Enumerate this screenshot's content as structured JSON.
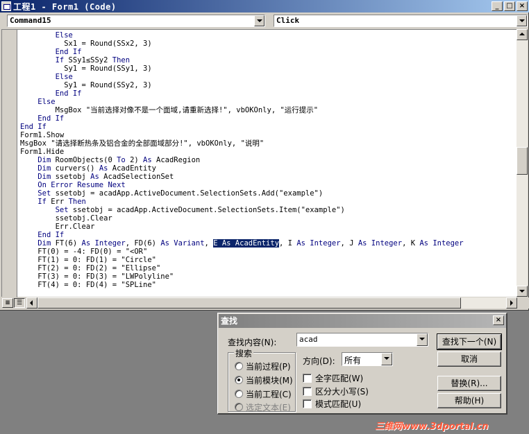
{
  "window": {
    "title": "工程1 - Form1 (Code)",
    "object_combo": "Command15",
    "procedure_combo": "Click"
  },
  "code_lines": [
    [
      {
        "t": "        "
      },
      {
        "t": "Else",
        "c": "kw"
      }
    ],
    [
      {
        "t": "          Sx1 = Round(SSx2, 3)"
      }
    ],
    [
      {
        "t": "        "
      },
      {
        "t": "End If",
        "c": "kw"
      }
    ],
    [
      {
        "t": "        "
      },
      {
        "t": "If",
        "c": "kw"
      },
      {
        "t": " SSy1≤SSy2 "
      },
      {
        "t": "Then",
        "c": "kw"
      }
    ],
    [
      {
        "t": "          Sy1 = Round(SSy1, 3)"
      }
    ],
    [
      {
        "t": "        "
      },
      {
        "t": "Else",
        "c": "kw"
      }
    ],
    [
      {
        "t": "          Sy1 = Round(SSy2, 3)"
      }
    ],
    [
      {
        "t": "        "
      },
      {
        "t": "End If",
        "c": "kw"
      }
    ],
    [
      {
        "t": "    "
      },
      {
        "t": "Else",
        "c": "kw"
      }
    ],
    [
      {
        "t": "        MsgBox \"当前选择对像不是一个面域,请重新选择!\", vbOKOnly, \"运行提示\""
      }
    ],
    [
      {
        "t": "    "
      },
      {
        "t": "End If",
        "c": "kw"
      }
    ],
    [
      {
        "t": "End If",
        "c": "kw"
      }
    ],
    [
      {
        "t": "Form1.Show"
      }
    ],
    [
      {
        "t": "MsgBox \"请选择断热条及铝合金的全部面域部分!\", vbOKOnly, \"说明\""
      }
    ],
    [
      {
        "t": "Form1.Hide"
      }
    ],
    [
      {
        "t": "    "
      },
      {
        "t": "Dim",
        "c": "kw"
      },
      {
        "t": " RoomObjects(0 "
      },
      {
        "t": "To",
        "c": "kw"
      },
      {
        "t": " 2) "
      },
      {
        "t": "As",
        "c": "kw"
      },
      {
        "t": " AcadRegion"
      }
    ],
    [
      {
        "t": "    "
      },
      {
        "t": "Dim",
        "c": "kw"
      },
      {
        "t": " curvers() "
      },
      {
        "t": "As",
        "c": "kw"
      },
      {
        "t": " AcadEntity"
      }
    ],
    [
      {
        "t": "    "
      },
      {
        "t": "Dim",
        "c": "kw"
      },
      {
        "t": " ssetobj "
      },
      {
        "t": "As",
        "c": "kw"
      },
      {
        "t": " AcadSelectionSet"
      }
    ],
    [
      {
        "t": "    "
      },
      {
        "t": "On Error Resume Next",
        "c": "kw"
      }
    ],
    [
      {
        "t": "    "
      },
      {
        "t": "Set",
        "c": "kw"
      },
      {
        "t": " ssetobj = acadApp.ActiveDocument.SelectionSets.Add(\"example\")"
      }
    ],
    [
      {
        "t": "    "
      },
      {
        "t": "If",
        "c": "kw"
      },
      {
        "t": " Err "
      },
      {
        "t": "Then",
        "c": "kw"
      }
    ],
    [
      {
        "t": "        "
      },
      {
        "t": "Set",
        "c": "kw"
      },
      {
        "t": " ssetobj = acadApp.ActiveDocument.SelectionSets.Item(\"example\")"
      }
    ],
    [
      {
        "t": "        ssetobj.Clear"
      }
    ],
    [
      {
        "t": "        Err.Clear"
      }
    ],
    [
      {
        "t": "    "
      },
      {
        "t": "End If",
        "c": "kw"
      }
    ],
    [
      {
        "t": "    "
      },
      {
        "t": "Dim",
        "c": "kw"
      },
      {
        "t": " FT(6) "
      },
      {
        "t": "As Integer",
        "c": "kw"
      },
      {
        "t": ", FD(6) "
      },
      {
        "t": "As Variant",
        "c": "kw"
      },
      {
        "t": ", "
      },
      {
        "t": "E As AcadEntity",
        "c": "sel"
      },
      {
        "t": ", I "
      },
      {
        "t": "As Integer",
        "c": "kw"
      },
      {
        "t": ", J "
      },
      {
        "t": "As Integer",
        "c": "kw"
      },
      {
        "t": ", K "
      },
      {
        "t": "As Integer",
        "c": "kw"
      }
    ],
    [
      {
        "t": "    FT(0) = -4: FD(0) = \"<OR\""
      }
    ],
    [
      {
        "t": "    FT(1) = 0: FD(1) = \"Circle\""
      }
    ],
    [
      {
        "t": "    FT(2) = 0: FD(2) = \"Ellipse\""
      }
    ],
    [
      {
        "t": "    FT(3) = 0: FD(3) = \"LWPolyline\""
      }
    ],
    [
      {
        "t": "    FT(4) = 0: FD(4) = \"SPLine\""
      }
    ]
  ],
  "find_dialog": {
    "title": "查找",
    "find_what_label": "查找内容(N):",
    "find_what_value": "acad",
    "search_group_label": "搜索",
    "scope_options": [
      {
        "label": "当前过程(P)",
        "checked": false,
        "enabled": true
      },
      {
        "label": "当前模块(M)",
        "checked": true,
        "enabled": true
      },
      {
        "label": "当前工程(C)",
        "checked": false,
        "enabled": true
      },
      {
        "label": "选定文本(E)",
        "checked": false,
        "enabled": false
      }
    ],
    "direction_label": "方向(D):",
    "direction_value": "所有",
    "checkboxes": [
      {
        "label": "全字匹配(W)",
        "checked": false
      },
      {
        "label": "区分大小写(S)",
        "checked": false
      },
      {
        "label": "模式匹配(U)",
        "checked": false
      }
    ],
    "buttons": {
      "find_next": "查找下一个(N)",
      "cancel": "取消",
      "replace": "替换(R)...",
      "help": "帮助(H)"
    }
  },
  "watermark": "三维网www.3dportal.cn"
}
